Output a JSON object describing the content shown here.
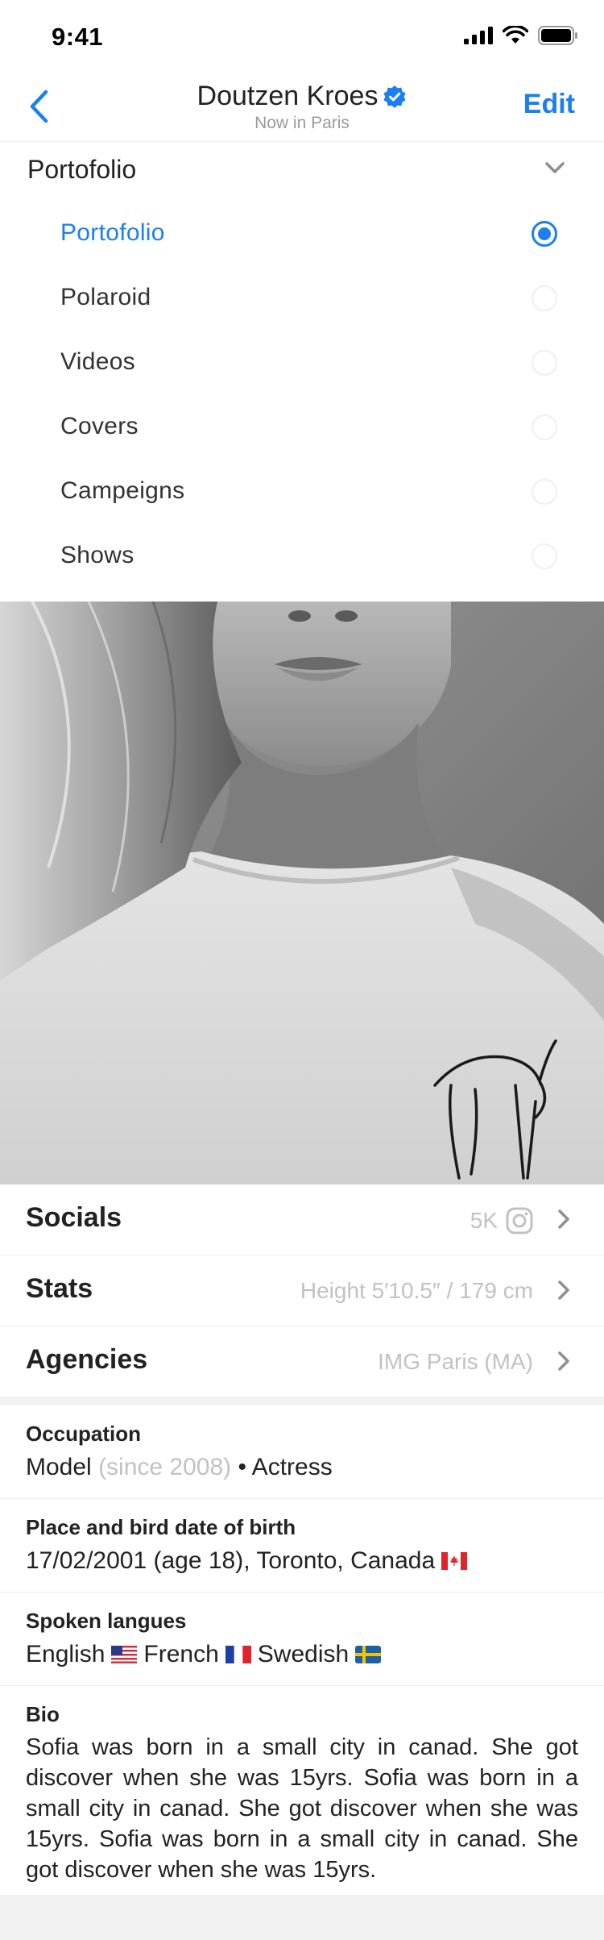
{
  "status_bar": {
    "time": "9:41"
  },
  "nav": {
    "title": "Doutzen Kroes",
    "subtitle": "Now in Paris",
    "edit_label": "Edit"
  },
  "dropdown": {
    "title": "Portofolio",
    "options": [
      {
        "label": "Portofolio",
        "selected": true
      },
      {
        "label": "Polaroid",
        "selected": false
      },
      {
        "label": "Videos",
        "selected": false
      },
      {
        "label": "Covers",
        "selected": false
      },
      {
        "label": "Campeigns",
        "selected": false
      },
      {
        "label": "Shows",
        "selected": false
      }
    ]
  },
  "links": [
    {
      "label": "Socials",
      "value": "5K",
      "icon": "instagram-icon"
    },
    {
      "label": "Stats",
      "value": "Height 5′10.5″ / 179 cm"
    },
    {
      "label": "Agencies",
      "value": "IMG Paris (MA)"
    }
  ],
  "info": {
    "occupation": {
      "label": "Occupation",
      "primary": "Model",
      "since": "(since 2008)",
      "secondary": "• Actress"
    },
    "birth": {
      "label": "Place and bird date of birth",
      "value": "17/02/2001 (age 18), Toronto, Canada"
    },
    "languages": {
      "label": "Spoken langues",
      "items": [
        {
          "name": "English",
          "flag": "us-flag"
        },
        {
          "name": "French",
          "flag": "fr-flag"
        },
        {
          "name": "Swedish",
          "flag": "se-flag"
        }
      ]
    },
    "bio": {
      "label": "Bio",
      "text": "Sofia was born in a small city in canad. She got discover when she was 15yrs. Sofia was born in a small city in canad. She got discover when she was 15yrs. Sofia was born in a small city in canad. She got discover when she was 15yrs."
    }
  },
  "colors": {
    "accent": "#1b7ff0",
    "muted": "#c2c2c2",
    "text": "#222222"
  }
}
